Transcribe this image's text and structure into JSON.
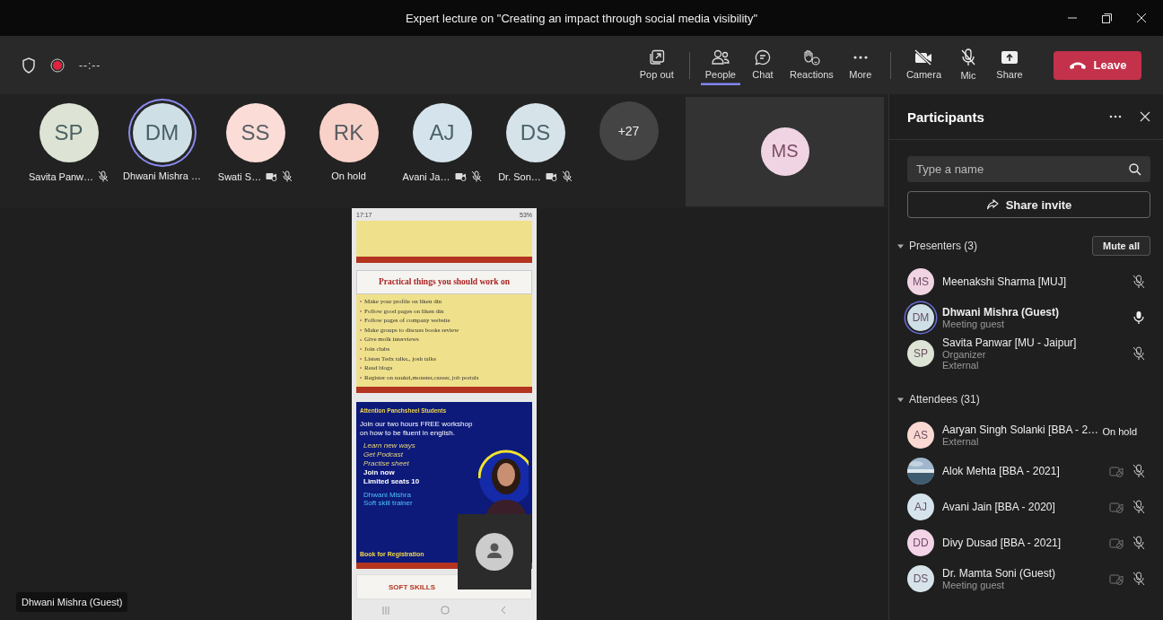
{
  "window": {
    "title": "Expert lecture on \"Creating an impact through social media visibility\""
  },
  "meeting_bar": {
    "timer": "--:--",
    "recording": true
  },
  "view_tools": [
    {
      "label": "Pop out"
    }
  ],
  "panel_tools": [
    {
      "label": "People",
      "selected": true
    },
    {
      "label": "Chat",
      "selected": false
    },
    {
      "label": "Reactions",
      "selected": false
    },
    {
      "label": "More",
      "selected": false
    }
  ],
  "device_tools": [
    {
      "label": "Camera"
    },
    {
      "label": "Mic"
    },
    {
      "label": "Share"
    }
  ],
  "leave_button": {
    "label": "Leave"
  },
  "gallery": {
    "tiles": [
      {
        "initials": "SP",
        "name": "Savita Panw…",
        "color": "#dde4d5",
        "speaking": false,
        "camera_off": false,
        "muted": true
      },
      {
        "initials": "DM",
        "name": "Dhwani Mishra …",
        "color": "#cfdfe6",
        "speaking": true,
        "camera_off": false,
        "muted": false
      },
      {
        "initials": "SS",
        "name": "Swati S…",
        "color": "#fbdcd6",
        "speaking": false,
        "camera_off": true,
        "muted": true
      },
      {
        "initials": "RK",
        "name": "On hold",
        "color": "#f8d2c9",
        "speaking": false,
        "camera_off": false,
        "muted": false
      },
      {
        "initials": "AJ",
        "name": "Avani Ja…",
        "color": "#d5e4ec",
        "speaking": false,
        "camera_off": true,
        "muted": true
      },
      {
        "initials": "DS",
        "name": "Dr. Son…",
        "color": "#d6e4ea",
        "speaking": false,
        "camera_off": true,
        "muted": true
      }
    ],
    "overflow": "+27"
  },
  "spotlight": {
    "initials": "MS",
    "color": "#f0d4e3"
  },
  "shared_screen": {
    "status_time": "17:17",
    "status_battery": "53%",
    "slides": [
      {
        "kind": "blank"
      },
      {
        "kind": "list",
        "title": "Practical things you should work  on",
        "items": [
          "Make your profile on liken din",
          "Follow good pages on liken din",
          "Follow pages of company website",
          "Make groups to discuss books review",
          "Give molk interviews",
          "Join clubs",
          "Listen Tedx talks,, josh talks",
          "Read blogs",
          "Register on naukri,monster,career, job portals"
        ]
      },
      {
        "kind": "poster",
        "heading": "Attention Panchsheel Students",
        "intro": "Join our two hours FREE workshop on how to be fluent in english.",
        "points": [
          "Learn new ways",
          "Get Podcast",
          "Practise sheet"
        ],
        "highlights": [
          "Join now",
          "Limited seats 10"
        ],
        "trainer": [
          "Dhwani Mishra",
          "Soft skill trainer"
        ],
        "cta": "Book for Registration"
      },
      {
        "kind": "title",
        "title": "SOFT SKILLS"
      }
    ]
  },
  "stage_label": "Dhwani Mishra (Guest)",
  "participants": {
    "title": "Participants",
    "search": {
      "placeholder": "Type a name"
    },
    "share_invite": "Share invite",
    "sections": [
      {
        "title": "Presenters (3)",
        "expanded": true,
        "action": "Mute all",
        "people": [
          {
            "kind": "initials",
            "initials": "MS",
            "color": "#f0d4e3",
            "name": "Meenakshi Sharma [MUJ]",
            "speaking": false,
            "muted": true,
            "camera_off": false
          },
          {
            "kind": "initials",
            "initials": "DM",
            "color": "#cfdfe6",
            "name": "Dhwani Mishra (Guest)",
            "details": [
              "Meeting guest"
            ],
            "speaking": true,
            "muted": false,
            "camera_off": false
          },
          {
            "kind": "initials",
            "initials": "SP",
            "color": "#dde4d5",
            "name": "Savita Panwar [MU - Jaipur]",
            "details": [
              "Organizer",
              "External"
            ],
            "speaking": false,
            "muted": true,
            "camera_off": false
          }
        ]
      },
      {
        "title": "Attendees (31)",
        "expanded": true,
        "people": [
          {
            "kind": "initials",
            "initials": "AS",
            "color": "#f9d9d2",
            "name": "Aaryan Singh Solanki [BBA - 2…",
            "details": [
              "External"
            ],
            "speaking": false,
            "status": "On hold",
            "camera_off": false
          },
          {
            "kind": "picture",
            "name": "Alok Mehta [BBA - 2021]",
            "speaking": false,
            "muted": true,
            "camera_off": true
          },
          {
            "kind": "initials",
            "initials": "AJ",
            "color": "#d5e4ec",
            "name": "Avani Jain [BBA - 2020]",
            "speaking": false,
            "muted": true,
            "camera_off": true
          },
          {
            "kind": "initials",
            "initials": "DD",
            "color": "#f3d3e6",
            "name": "Divy Dusad [BBA - 2021]",
            "speaking": false,
            "muted": true,
            "camera_off": true
          },
          {
            "kind": "initials",
            "initials": "DS",
            "color": "#d6e4ea",
            "name": "Dr. Mamta Soni (Guest)",
            "details": [
              "Meeting guest"
            ],
            "speaking": false,
            "muted": true,
            "camera_off": true
          }
        ]
      }
    ]
  }
}
